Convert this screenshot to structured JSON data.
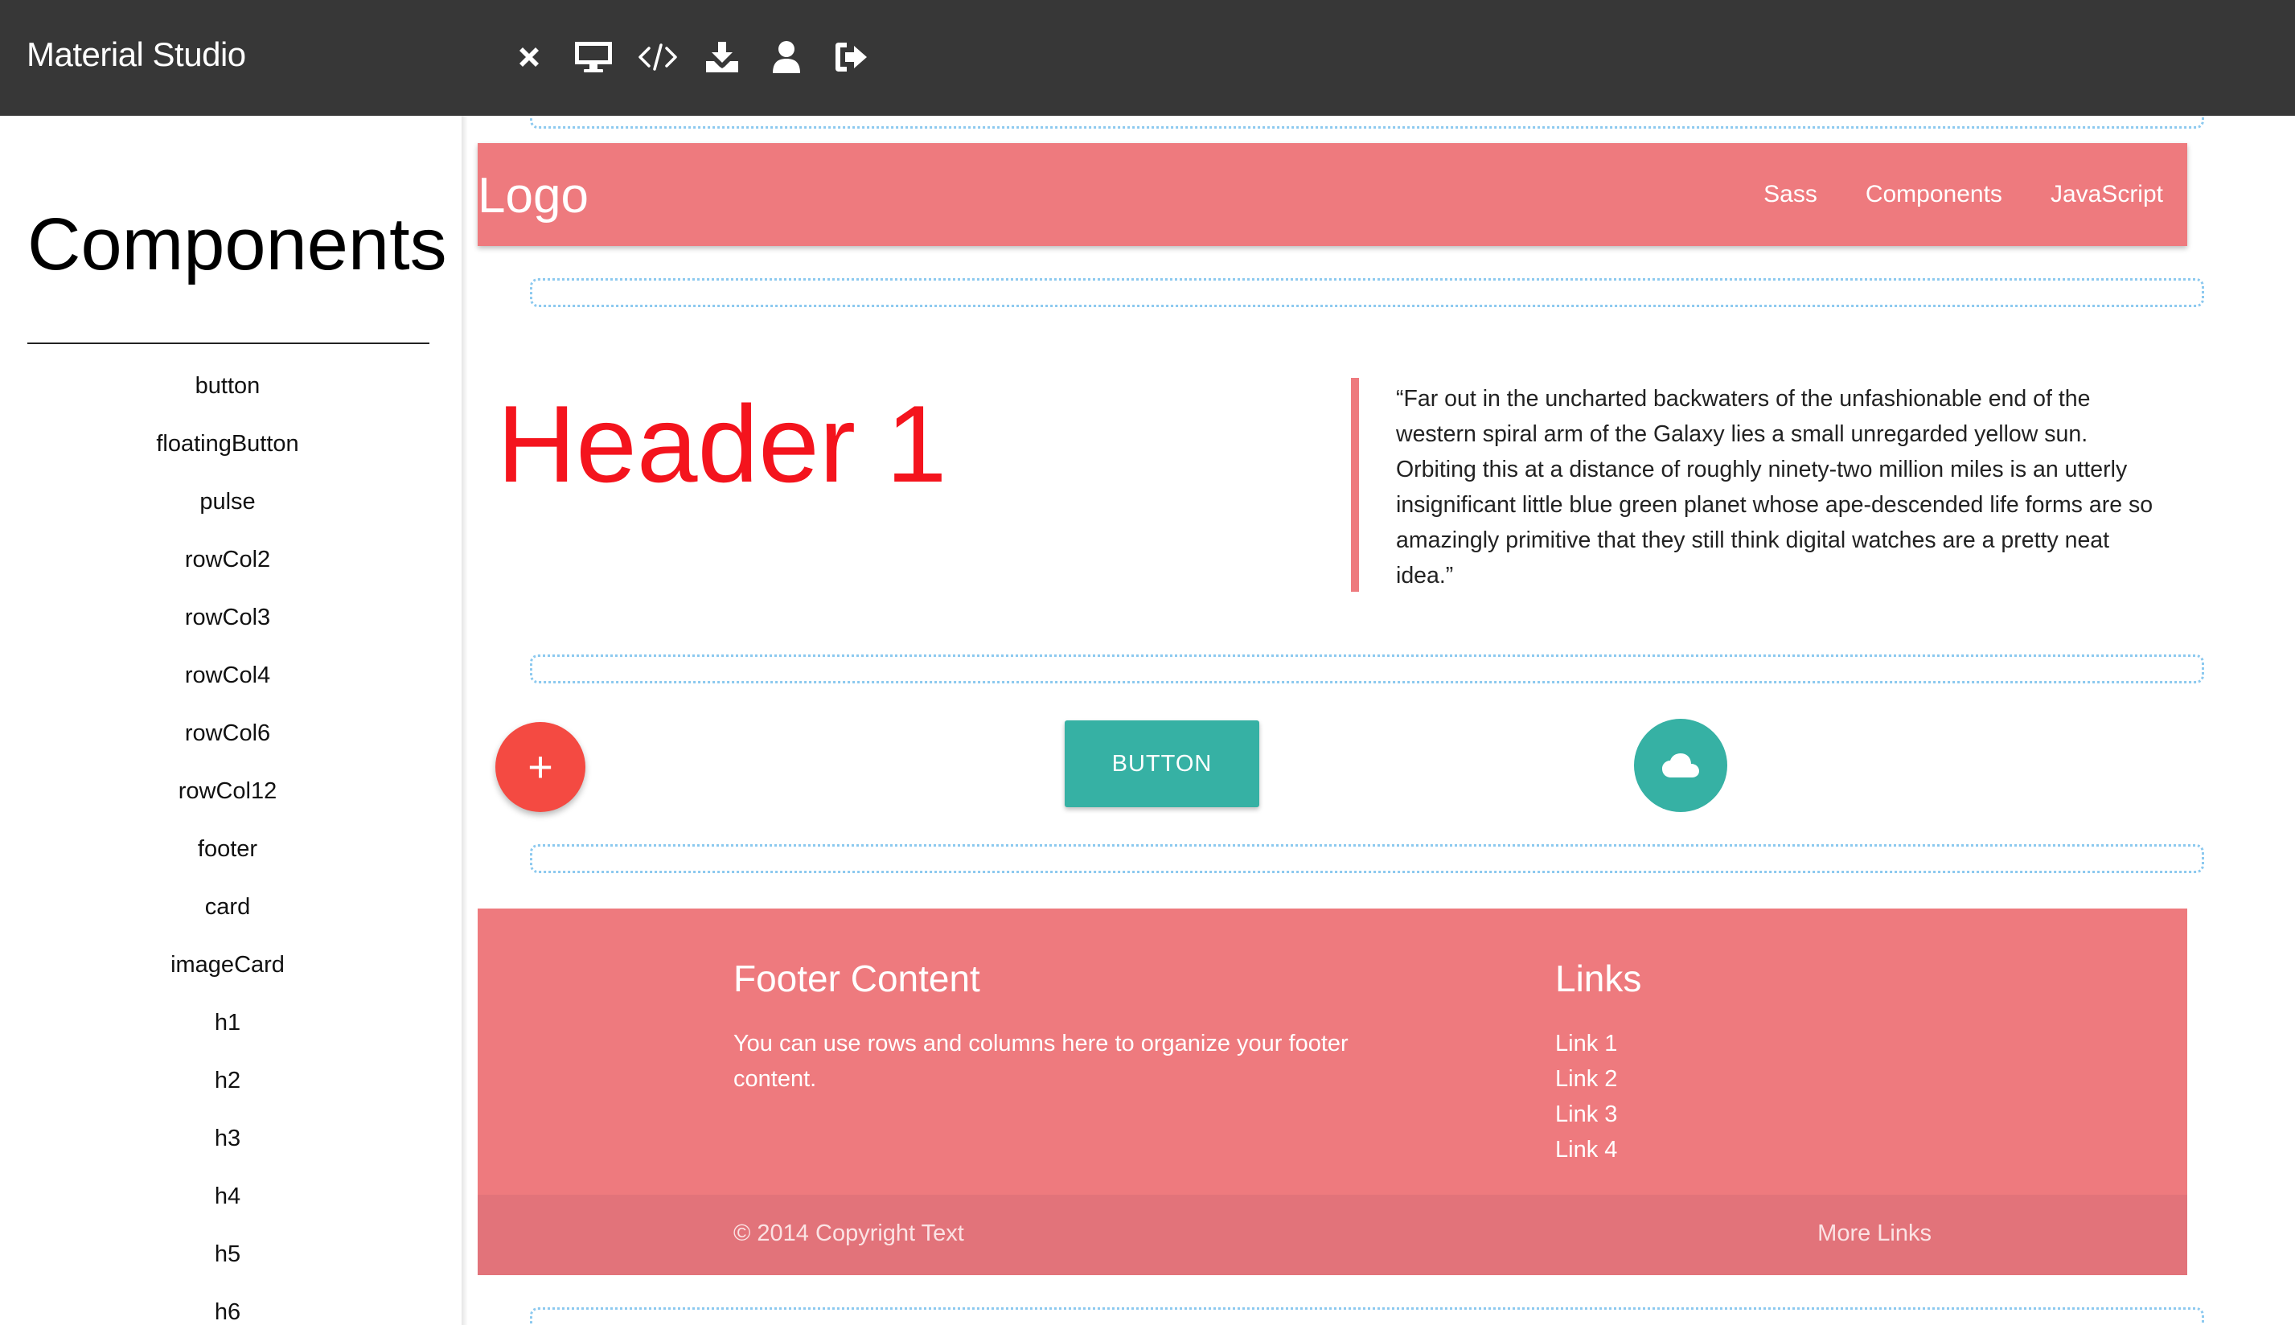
{
  "app": {
    "title": "Material Studio"
  },
  "toolbar": {
    "tools": [
      {
        "icon": "close-icon"
      },
      {
        "icon": "desktop-icon"
      },
      {
        "icon": "code-icon"
      },
      {
        "icon": "download-icon"
      },
      {
        "icon": "user-icon"
      },
      {
        "icon": "sign-out-icon"
      }
    ]
  },
  "sidebar": {
    "title": "Components",
    "items": [
      "button",
      "floatingButton",
      "pulse",
      "rowCol2",
      "rowCol3",
      "rowCol4",
      "rowCol6",
      "rowCol12",
      "footer",
      "card",
      "imageCard",
      "h1",
      "h2",
      "h3",
      "h4",
      "h5",
      "h6"
    ]
  },
  "canvas": {
    "navbar": {
      "logo": "Logo",
      "links": [
        "Sass",
        "Components",
        "JavaScript"
      ],
      "color": "#ee7a7e"
    },
    "header1": {
      "text": "Header 1",
      "color": "#f4141d"
    },
    "quote": {
      "text": "“Far out in the uncharted backwaters of the unfashionable end of the western spiral arm of the Galaxy lies a small unregarded yellow sun. Orbiting this at a distance of roughly ninety-two million miles is an utterly insignificant little blue green planet whose ape-descended life forms are so amazingly primitive that they still think digital watches are a pretty neat idea.”"
    },
    "buttons": {
      "fab_red": {
        "label": "+",
        "color": "#f44a42"
      },
      "raised": {
        "label": "BUTTON",
        "color": "#36b1a4"
      },
      "fab_teal": {
        "icon": "cloud-icon",
        "color": "#36b1a4"
      }
    },
    "footer": {
      "title": "Footer Content",
      "text": "You can use rows and columns here to organize your footer content.",
      "links_title": "Links",
      "links": [
        "Link 1",
        "Link 2",
        "Link 3",
        "Link 4"
      ],
      "copyright": "© 2014 Copyright Text",
      "more_links": "More Links"
    }
  }
}
